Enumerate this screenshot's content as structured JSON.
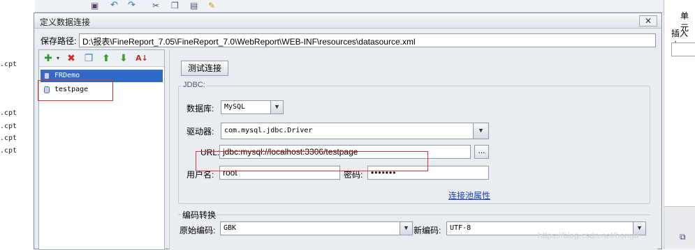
{
  "background": {
    "files": [
      ".cpt",
      ".cpt",
      ".cpt",
      ".cpt",
      ".cpt"
    ],
    "right_panel": {
      "title": "单元",
      "caption": "插入内"
    }
  },
  "dialog": {
    "title": "定义数据连接",
    "close_label": "✕",
    "save_path_label": "保存路径:",
    "save_path": "D:\\报表\\FineReport_7.05\\FineReport_7.0\\WebReport\\WEB-INF\\resources\\datasource.xml",
    "toolbar": {
      "add_icon": "plus-icon",
      "delete_icon": "delete-icon",
      "copy_icon": "copy-icon",
      "up_icon": "arrow-up-icon",
      "down_icon": "arrow-down-icon",
      "sort_icon": "sort-icon"
    },
    "connections": [
      {
        "name": "FRDemo",
        "selected": true
      },
      {
        "name": "testpage",
        "selected": false
      }
    ],
    "test_button": "测试连接",
    "jdbc": {
      "legend": "JDBC:",
      "database_label": "数据库:",
      "database_value": "MySQL",
      "driver_label": "驱动器:",
      "driver_value": "com.mysql.jdbc.Driver",
      "url_label": "URL:",
      "url_value": "jdbc:mysql://localhost:3306/testpage",
      "browse_label": "...",
      "username_label": "用户名:",
      "username_value": "root",
      "password_label": "密码:",
      "password_value": "•••••••",
      "pool_link": "连接池属性"
    },
    "encoding": {
      "legend": "编码转换",
      "original_label": "原始编码:",
      "original_value": "GBK",
      "new_label": "新编码:",
      "new_value": "UTF-8"
    }
  },
  "watermark": "https://blog.csdn.net/hongd"
}
